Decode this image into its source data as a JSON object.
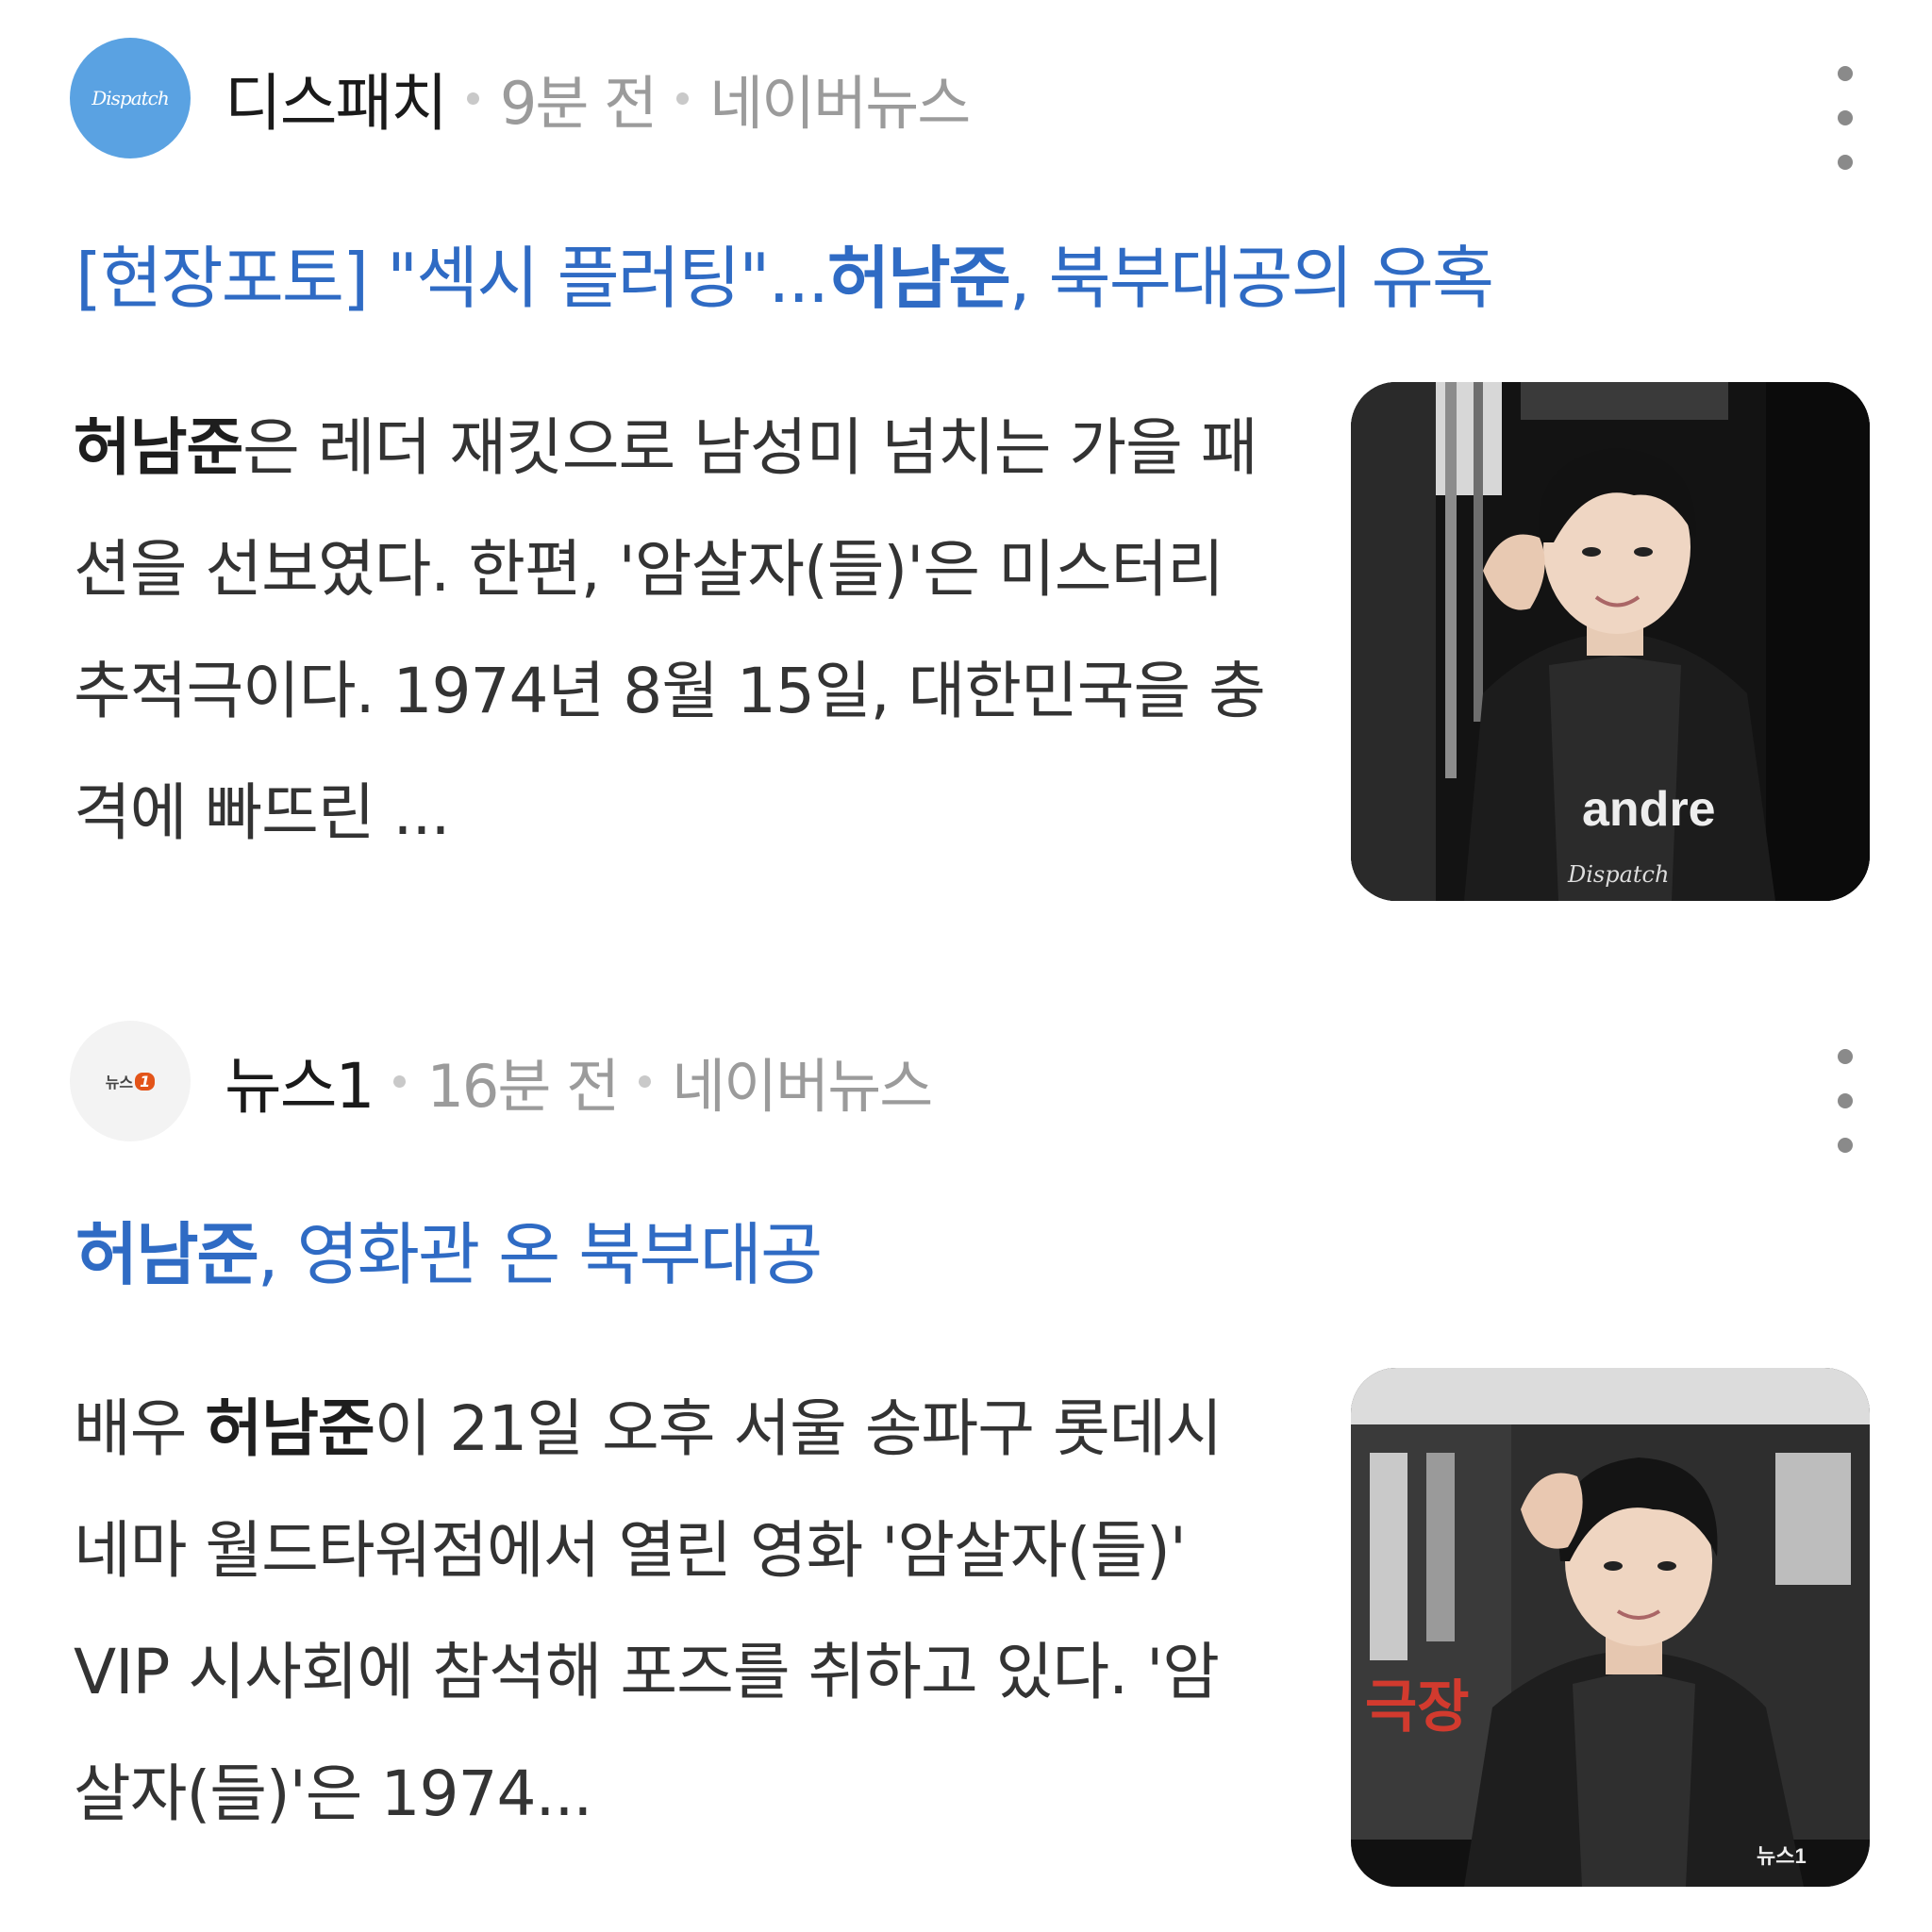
{
  "articles": [
    {
      "source": "디스패치",
      "source_logo_text": "Dispatch",
      "time_ago": "9분 전",
      "platform": "네이버뉴스",
      "headline_prefix": "[현장포토] \"섹시 플러팅\"...",
      "headline_bold": "허남준",
      "headline_suffix": ", 북부대공의 유혹",
      "summary_bold": "허남준",
      "summary_text": "은 레더 재킷으로 남성미 넘치는 가을 패션을 선보였다. 한편, '암살자(들)'은 미스터리 추적극이다. 1974년 8월 15일, 대한민국을 충격에 빠뜨린 ...",
      "thumb_shirt_text": "andre",
      "thumb_watermark": "Dispatch"
    },
    {
      "source": "뉴스1",
      "source_logo_text": "뉴스",
      "source_logo_mark": "1",
      "time_ago": "16분 전",
      "platform": "네이버뉴스",
      "headline_bold": "허남준",
      "headline_suffix": ", 영화관 온 북부대공",
      "summary_prefix": "배우 ",
      "summary_bold": "허남준",
      "summary_text": "이 21일 오후 서울 송파구 롯데시네마 월드타워점에서 열린 영화 '암살자(들)' VIP 시사회에 참석해 포즈를 취하고 있다. '암살자(들)'은 1974...",
      "thumb_poster_text": "극장",
      "thumb_watermark": "뉴스1"
    }
  ]
}
